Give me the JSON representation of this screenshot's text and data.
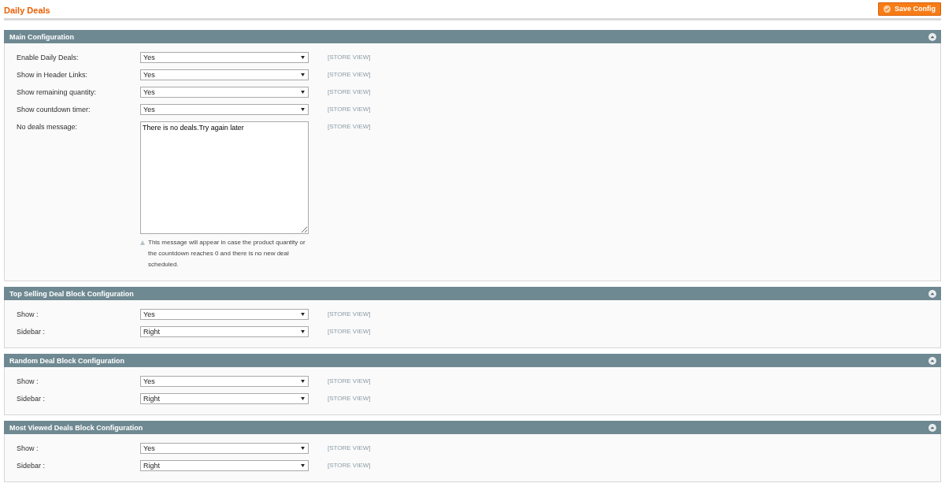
{
  "page_title": "Daily Deals",
  "save_button": {
    "label": "Save Config"
  },
  "sections": [
    {
      "title": "Main Configuration",
      "fields": [
        {
          "kind": "select",
          "label": "Enable Daily Deals:",
          "value": "Yes",
          "scope": "[STORE VIEW]"
        },
        {
          "kind": "select",
          "label": "Show in Header Links:",
          "value": "Yes",
          "scope": "[STORE VIEW]"
        },
        {
          "kind": "select",
          "label": "Show remaining quantity:",
          "value": "Yes",
          "scope": "[STORE VIEW]"
        },
        {
          "kind": "select",
          "label": "Show countdown timer:",
          "value": "Yes",
          "scope": "[STORE VIEW]"
        },
        {
          "kind": "textarea",
          "label": "No deals message:",
          "value": "There is no deals.Try again later",
          "scope": "[STORE VIEW]",
          "note": "This message will appear in case the product quantity or the countdown reaches 0 and there is no new deal scheduled."
        }
      ]
    },
    {
      "title": "Top Selling Deal Block Configuration",
      "fields": [
        {
          "kind": "select",
          "label": "Show :",
          "value": "Yes",
          "scope": "[STORE VIEW]"
        },
        {
          "kind": "select",
          "label": "Sidebar :",
          "value": "Right",
          "scope": "[STORE VIEW]"
        }
      ]
    },
    {
      "title": "Random Deal Block Configuration",
      "fields": [
        {
          "kind": "select",
          "label": "Show :",
          "value": "Yes",
          "scope": "[STORE VIEW]"
        },
        {
          "kind": "select",
          "label": "Sidebar :",
          "value": "Right",
          "scope": "[STORE VIEW]"
        }
      ]
    },
    {
      "title": "Most Viewed Deals Block Configuration",
      "fields": [
        {
          "kind": "select",
          "label": "Show :",
          "value": "Yes",
          "scope": "[STORE VIEW]"
        },
        {
          "kind": "select",
          "label": "Sidebar :",
          "value": "Right",
          "scope": "[STORE VIEW]"
        }
      ]
    }
  ]
}
